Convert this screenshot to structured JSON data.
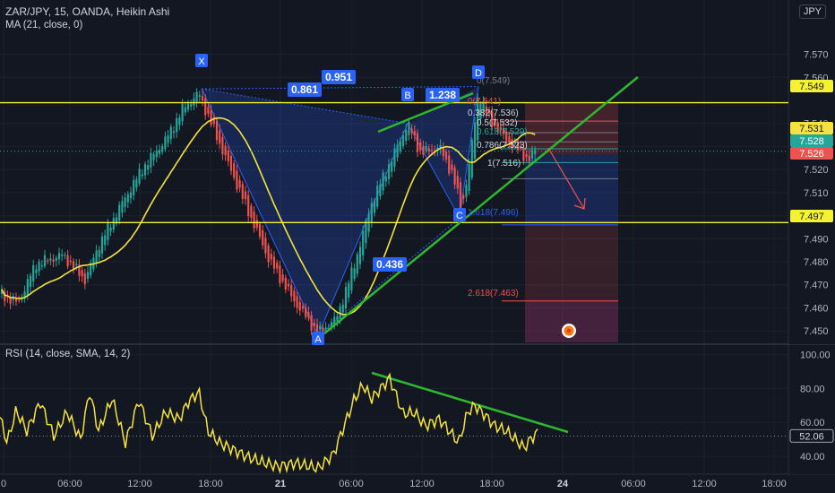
{
  "header": {
    "symbol_line": "ZAR/JPY, 15, OANDA, Heikin Ashi",
    "ma_line": "MA (21, close, 0)",
    "rsi_line": "RSI (14, close, SMA, 14, 2)",
    "currency": "JPY"
  },
  "colors": {
    "background": "#131722",
    "grid": "#1e222d",
    "bull": "#26a69a",
    "bear": "#ef5350",
    "ma": "#f5e33d",
    "trend": "#2fb82f",
    "level": "#f5f233",
    "pattern": "#2962ff",
    "axis_text": "#b2b5be"
  },
  "price_axis": {
    "ticks": [
      "7.570",
      "7.560",
      "7.540",
      "7.530",
      "7.520",
      "7.510",
      "7.500",
      "7.490",
      "7.480",
      "7.470",
      "7.460",
      "7.450"
    ]
  },
  "rsi_axis": {
    "ticks": [
      "100.00",
      "80.00",
      "60.00",
      "40.00"
    ]
  },
  "time_axis": {
    "ticks": [
      "0",
      "06:00",
      "12:00",
      "18:00",
      "21",
      "06:00",
      "12:00",
      "18:00",
      "24",
      "06:00",
      "12:00",
      "18:00"
    ]
  },
  "price_badges": [
    {
      "id": "level-upper",
      "price": 7.549,
      "label": "7.549",
      "bg": "#f5f233",
      "fg": "#131722"
    },
    {
      "id": "current-a",
      "price": 7.531,
      "label": "7.531",
      "bg": "#f5e33d",
      "fg": "#131722"
    },
    {
      "id": "current-b",
      "price": 7.528,
      "label": "7.528",
      "bg": "#26a69a",
      "fg": "#ffffff"
    },
    {
      "id": "current-c",
      "price": 7.526,
      "label": "7.526",
      "bg": "#ef5350",
      "fg": "#ffffff"
    },
    {
      "id": "level-lower",
      "price": 7.497,
      "label": "7.497",
      "bg": "#f5f233",
      "fg": "#131722"
    }
  ],
  "rsi_badge": {
    "value": 52.06,
    "label": "52.06"
  },
  "pattern_points": [
    {
      "label": "X",
      "price": 7.555
    },
    {
      "label": "A",
      "price": 7.448
    },
    {
      "label": "B",
      "price": 7.54
    },
    {
      "label": "C",
      "price": 7.499
    },
    {
      "label": "D",
      "price": 7.556
    }
  ],
  "ratios": [
    "0.861",
    "0.951",
    "1.238",
    "0.436"
  ],
  "fib_labels": [
    "0(7.549)",
    "0(7.541)",
    "0.382(7.536)",
    "0.5(7.532)",
    "0.618(7.529)",
    "0.786(7.523)",
    "1(7.516)",
    "1.618(7.496)",
    "2.618(7.463)"
  ],
  "chart_data": {
    "type": "candlestick",
    "panes": [
      {
        "name": "price",
        "ylim": [
          7.445,
          7.578
        ]
      },
      {
        "name": "rsi",
        "ylim": [
          30,
          104
        ]
      }
    ],
    "levels": [
      7.549,
      7.497
    ],
    "last_price": 7.528,
    "rsi_last": 52.06,
    "ma_period": 21,
    "rsi_period": 14
  }
}
